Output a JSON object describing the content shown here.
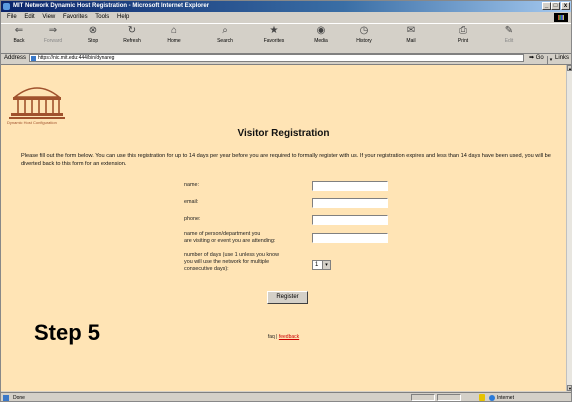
{
  "window": {
    "title": "MIT Network Dynamic Host Registration - Microsoft Internet Explorer",
    "controls": [
      "_",
      "□",
      "x"
    ]
  },
  "menu": [
    "File",
    "Edit",
    "View",
    "Favorites",
    "Tools",
    "Help"
  ],
  "toolbar": {
    "back": "Back",
    "forward": "Forward",
    "stop": "Stop",
    "refresh": "Refresh",
    "home": "Home",
    "search": "Search",
    "favorites": "Favorites",
    "media": "Media",
    "history": "History",
    "mail": "Mail",
    "print": "Print",
    "edit": "Edit"
  },
  "address": {
    "label": "Address",
    "url": "https://nic.mit.edu:444/bin/dynareg",
    "go": "Go",
    "links": "Links"
  },
  "page": {
    "logo_caption": "Dynamic Host Configuration",
    "heading": "Visitor Registration",
    "intro": "Please fill out the form below. You can use this registration for up to 14 days per year before you are required to formally register with us. If your registration expires and less than 14 days have been used, you will be diverted back to this form for an extension.",
    "fields": {
      "name": "name:",
      "email": "email:",
      "phone": "phone:",
      "person_line1": "name of person/department you",
      "person_line2": "are visiting or event you are attending:",
      "days_line1": "number of days (use 1 unless you know",
      "days_line2": "you will use the network for multiple",
      "days_line3": "consecutive days):"
    },
    "days_value": "1",
    "register_button": "Register",
    "faq": "faq",
    "faq_sep": " | ",
    "feedback": "feedback"
  },
  "overlay": {
    "step": "Step 5"
  },
  "status": {
    "done": "Done",
    "zone": "Internet"
  },
  "colors": {
    "page_background": "#ffe4b5",
    "titlebar": "#0a246a",
    "link": "#cc0000"
  }
}
